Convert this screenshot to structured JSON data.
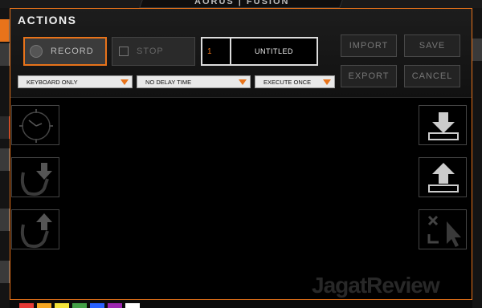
{
  "background": {
    "brand_text": "AORUS | FUSION",
    "palette": [
      "#e53935",
      "#f5a623",
      "#f3e33a",
      "#43a047",
      "#2962ff",
      "#9c27b0",
      "#ffffff"
    ]
  },
  "dialog": {
    "title": "ACTIONS",
    "record_label": "RECORD",
    "stop_label": "STOP",
    "macro": {
      "index": "1",
      "name": "UNTITLED"
    },
    "import_label": "IMPORT",
    "save_label": "SAVE",
    "export_label": "EXPORT",
    "cancel_label": "CANCEL",
    "dropdowns": {
      "record_mode": "KEYBOARD ONLY",
      "delay": "NO DELAY TIME",
      "execute": "EXECUTE ONCE"
    },
    "tools_left": [
      "clock-icon",
      "mouse-down-icon",
      "mouse-up-icon"
    ],
    "tools_right": [
      "key-down-icon",
      "key-up-icon",
      "delete-action-icon"
    ],
    "accent": "#e8731a"
  },
  "watermark": "JagatReview"
}
